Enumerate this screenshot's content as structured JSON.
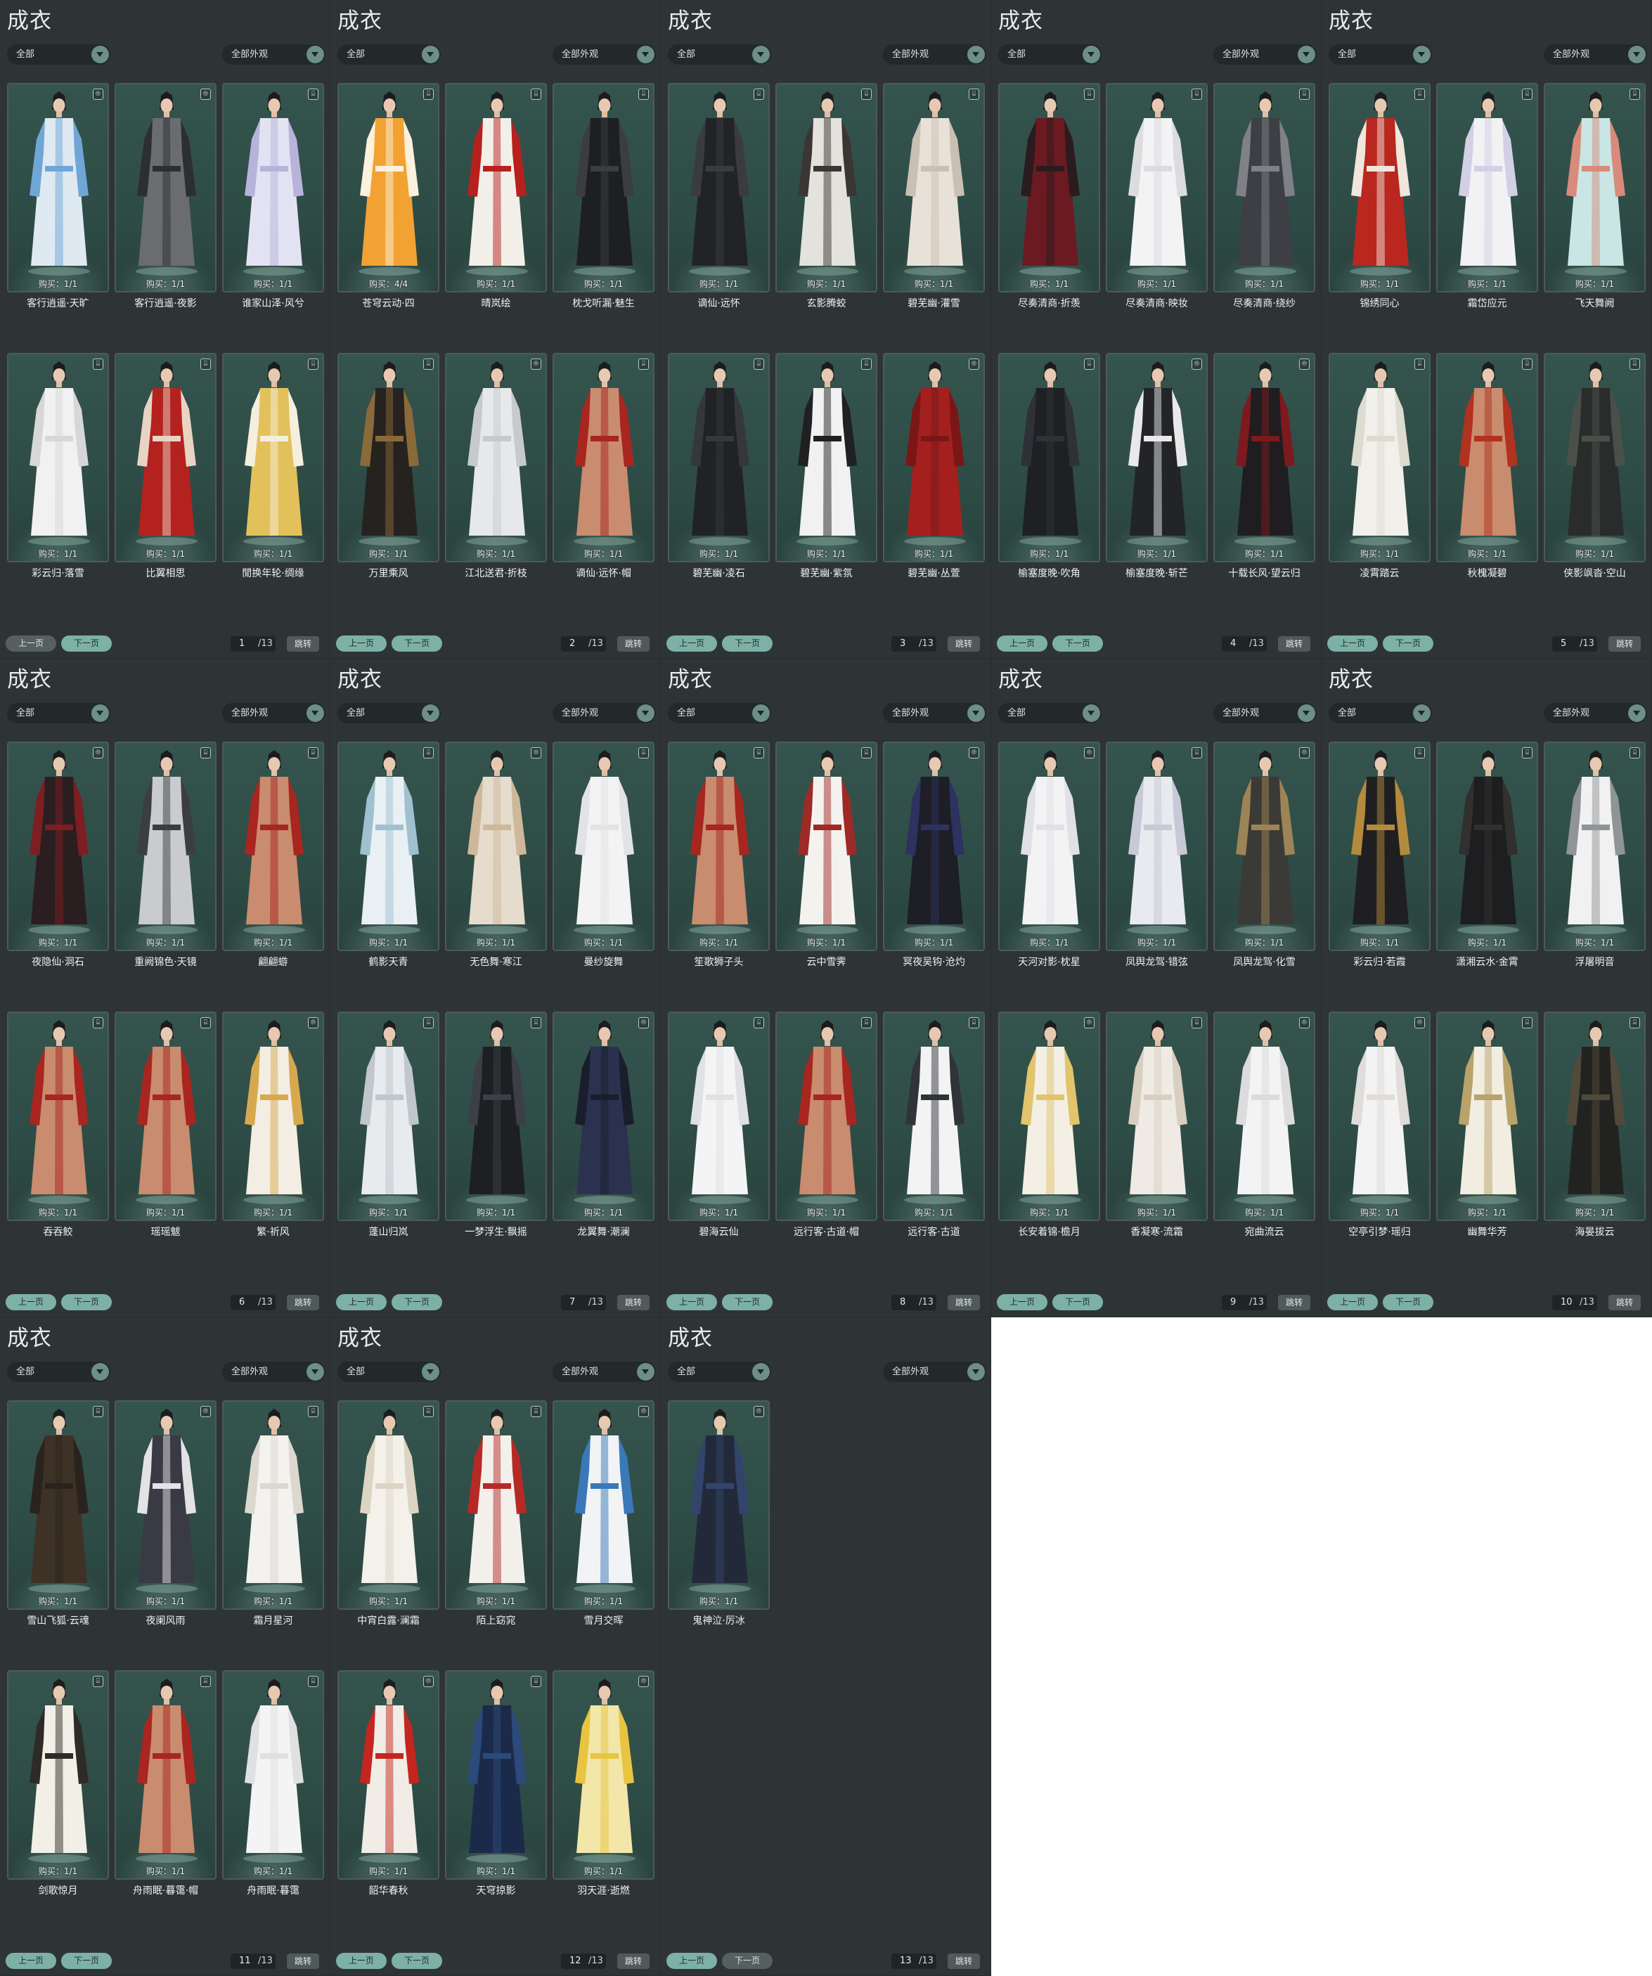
{
  "common": {
    "title": "成衣",
    "filter_left": "全部",
    "filter_right": "全部外观",
    "prev": "上一页",
    "next": "下一页",
    "total": "/13",
    "jump": "跳转"
  },
  "panels": [
    {
      "page": "1",
      "items": [
        {
          "name": "客行逍遥·天旷",
          "buy": "购买：1/1",
          "icon": "gift-icon",
          "colors": [
            "#dfe9f2",
            "#6fa6d6"
          ]
        },
        {
          "name": "客行逍遥·夜影",
          "buy": "购买：1/1",
          "icon": "gift-icon",
          "colors": [
            "#6a6c70",
            "#2d2e33"
          ]
        },
        {
          "name": "谁家山泽·风兮",
          "buy": "购买：1/1",
          "icon": "shop-icon",
          "colors": [
            "#e3e2f2",
            "#b7b3da"
          ]
        },
        {
          "name": "彩云归·落雪",
          "buy": "购买：1/1",
          "icon": "shop-icon",
          "colors": [
            "#f1f1f1",
            "#d7d7d7"
          ]
        },
        {
          "name": "比翼相思",
          "buy": "购买：1/1",
          "icon": "shop-icon",
          "colors": [
            "#b4221f",
            "#e9d3c4"
          ]
        },
        {
          "name": "閒换年轮·绸缘",
          "buy": "购买：1/1",
          "icon": "shop-icon",
          "colors": [
            "#e3c15a",
            "#f5efe0"
          ]
        }
      ]
    },
    {
      "page": "2",
      "items": [
        {
          "name": "苍穹云动·四",
          "buy": "购买：4/4",
          "icon": "shop-icon",
          "colors": [
            "#f2a233",
            "#fbf1dc"
          ]
        },
        {
          "name": "晴岚绘",
          "buy": "购买：1/1",
          "icon": "shop-icon",
          "colors": [
            "#f2efe9",
            "#b8201d"
          ]
        },
        {
          "name": "枕戈听漏·魅生",
          "buy": "购买：1/1",
          "icon": "shop-icon",
          "colors": [
            "#1e1f22",
            "#3b3d40"
          ]
        },
        {
          "name": "万里乘风",
          "buy": "购买：1/1",
          "icon": "shop-icon",
          "colors": [
            "#25221f",
            "#8b6a3a"
          ]
        },
        {
          "name": "江北送君·折枝",
          "buy": "购买：1/1",
          "icon": "gift-icon",
          "colors": [
            "#e6e8e9",
            "#c7cacc"
          ]
        },
        {
          "name": "谪仙·远怀·帽",
          "buy": "购买：1/1",
          "icon": "shop-icon",
          "colors": [
            "#c98c6e",
            "#a8261f"
          ]
        }
      ]
    },
    {
      "page": "3",
      "items": [
        {
          "name": "谪仙·远怀",
          "buy": "购买：1/1",
          "icon": "shop-icon",
          "colors": [
            "#222326",
            "#3a3b3f"
          ]
        },
        {
          "name": "玄影腾蛟",
          "buy": "购买：1/1",
          "icon": "shop-icon",
          "colors": [
            "#e4e2dd",
            "#3a3633"
          ]
        },
        {
          "name": "碧芜幽·灌雪",
          "buy": "购买：1/1",
          "icon": "shop-icon",
          "colors": [
            "#e8e1d8",
            "#c9bfb3"
          ]
        },
        {
          "name": "碧芜幽·凌石",
          "buy": "购买：1/1",
          "icon": "shop-icon",
          "colors": [
            "#202226",
            "#35373c"
          ]
        },
        {
          "name": "碧芜幽·紫氛",
          "buy": "购买：1/1",
          "icon": "shop-icon",
          "colors": [
            "#f1f1f1",
            "#1f2022"
          ]
        },
        {
          "name": "碧芜幽·丛萱",
          "buy": "购买：1/1",
          "icon": "gift-icon",
          "colors": [
            "#a3201f",
            "#7a1716"
          ]
        }
      ]
    },
    {
      "page": "4",
      "items": [
        {
          "name": "尽奏清商·折羡",
          "buy": "购买：1/1",
          "icon": "shop-icon",
          "colors": [
            "#6b1a22",
            "#2c1b1e"
          ]
        },
        {
          "name": "尽奏清商·映妆",
          "buy": "购买：1/1",
          "icon": "shop-icon",
          "colors": [
            "#f3f3f4",
            "#dadcdf"
          ]
        },
        {
          "name": "尽奏清商·绕纱",
          "buy": "购买：1/1",
          "icon": "shop-icon",
          "colors": [
            "#3d3f44",
            "#7f8186"
          ]
        },
        {
          "name": "榆塞度晚·吹角",
          "buy": "购买：1/1",
          "icon": "shop-icon",
          "colors": [
            "#1e2024",
            "#2f3136"
          ]
        },
        {
          "name": "榆塞度晚·斩芒",
          "buy": "购买：1/1",
          "icon": "gift-icon",
          "colors": [
            "#222428",
            "#e9e9e9"
          ]
        },
        {
          "name": "十载长风·望云归",
          "buy": "购买：1/1",
          "icon": "gift-icon",
          "colors": [
            "#1f1d20",
            "#7c1a1f"
          ]
        }
      ]
    },
    {
      "page": "5",
      "items": [
        {
          "name": "锦绣同心",
          "buy": "购买：1/1",
          "icon": "shop-icon",
          "colors": [
            "#b9271f",
            "#f0e6dc"
          ]
        },
        {
          "name": "霜岱应元",
          "buy": "购买：1/1",
          "icon": "shop-icon",
          "colors": [
            "#f2f1f4",
            "#d3cfe4"
          ]
        },
        {
          "name": "飞天舞阙",
          "buy": "购买：1/1",
          "icon": "shop-icon",
          "colors": [
            "#c9e6e4",
            "#d88b7b"
          ]
        },
        {
          "name": "凌霄踏云",
          "buy": "购买：1/1",
          "icon": "shop-icon",
          "colors": [
            "#f1f0ea",
            "#dedbd0"
          ]
        },
        {
          "name": "秋槐凝碧",
          "buy": "购买：1/1",
          "icon": "shop-icon",
          "colors": [
            "#c98c6e",
            "#b1321f"
          ]
        },
        {
          "name": "侠影飒沓·空山",
          "buy": "购买：1/1",
          "icon": "shop-icon",
          "colors": [
            "#2a2c2b",
            "#4b4f4a"
          ]
        }
      ]
    },
    {
      "page": "6",
      "items": [
        {
          "name": "夜隐仙·洞石",
          "buy": "购买：1/1",
          "icon": "gift-icon",
          "colors": [
            "#2a1e20",
            "#7d1e22"
          ]
        },
        {
          "name": "重阙锦色·天镜",
          "buy": "购买：1/1",
          "icon": "shop-icon",
          "colors": [
            "#c9cbce",
            "#3c3d41"
          ]
        },
        {
          "name": "翩翩蝣",
          "buy": "购买：1/1",
          "icon": "shop-icon",
          "colors": [
            "#c98c6e",
            "#a8261f"
          ]
        },
        {
          "name": "吞吞鲛",
          "buy": "购买：1/1",
          "icon": "shop-icon",
          "colors": [
            "#c98c6e",
            "#a8261f"
          ]
        },
        {
          "name": "瑶瑶魃",
          "buy": "购买：1/1",
          "icon": "shop-icon",
          "colors": [
            "#c98c6e",
            "#a8261f"
          ]
        },
        {
          "name": "繁·祈风",
          "buy": "购买：1/1",
          "icon": "gift-icon",
          "colors": [
            "#f3ede3",
            "#d7a94e"
          ]
        }
      ]
    },
    {
      "page": "7",
      "items": [
        {
          "name": "鹤影天青",
          "buy": "购买：1/1",
          "icon": "shop-icon",
          "colors": [
            "#e9f0f3",
            "#9fc1cf"
          ]
        },
        {
          "name": "无色舞·寒江",
          "buy": "购买：1/1",
          "icon": "gift-icon",
          "colors": [
            "#e6dccd",
            "#cdb89a"
          ]
        },
        {
          "name": "曼纱旋舞",
          "buy": "购买：1/1",
          "icon": "shop-icon",
          "colors": [
            "#f3f3f3",
            "#e1e3e6"
          ]
        },
        {
          "name": "蓬山归岚",
          "buy": "购买：1/1",
          "icon": "shop-icon",
          "colors": [
            "#e7ebee",
            "#bfc6cc"
          ]
        },
        {
          "name": "一梦浮生·飘摇",
          "buy": "购买：1/1",
          "icon": "shop-icon",
          "colors": [
            "#1d1f23",
            "#3c3f45"
          ]
        },
        {
          "name": "龙翼舞·潮澜",
          "buy": "购买：1/1",
          "icon": "gift-icon",
          "colors": [
            "#2b3250",
            "#1a1d2c"
          ]
        }
      ]
    },
    {
      "page": "8",
      "items": [
        {
          "name": "笙歌狮子头",
          "buy": "购买：1/1",
          "icon": "shop-icon",
          "colors": [
            "#c98c6e",
            "#a8261f"
          ]
        },
        {
          "name": "云中雪霁",
          "buy": "购买：1/1",
          "icon": "shop-icon",
          "colors": [
            "#f4f2ef",
            "#9d2a26"
          ]
        },
        {
          "name": "冥夜吴钩·沧灼",
          "buy": "购买：1/1",
          "icon": "gift-icon",
          "colors": [
            "#1d1e26",
            "#2d3260"
          ]
        },
        {
          "name": "碧海云仙",
          "buy": "购买：1/1",
          "icon": "shop-icon",
          "colors": [
            "#f4f4f5",
            "#dfe1e4"
          ]
        },
        {
          "name": "远行客·古道·帽",
          "buy": "购买：1/1",
          "icon": "shop-icon",
          "colors": [
            "#c98c6e",
            "#a8261f"
          ]
        },
        {
          "name": "远行客·古道",
          "buy": "购买：1/1",
          "icon": "shop-icon",
          "colors": [
            "#f3f3f3",
            "#303339"
          ]
        }
      ]
    },
    {
      "page": "9",
      "items": [
        {
          "name": "天河对影·枕星",
          "buy": "购买：1/1",
          "icon": "gift-icon",
          "colors": [
            "#f3f3f4",
            "#dfe1e6"
          ]
        },
        {
          "name": "凤舆龙驾·错弦",
          "buy": "购买：1/1",
          "icon": "shop-icon",
          "colors": [
            "#e9e9f0",
            "#c8c8d6"
          ]
        },
        {
          "name": "凤舆龙驾·化雪",
          "buy": "购买：1/1",
          "icon": "gift-icon",
          "colors": [
            "#3c3a36",
            "#9d8456"
          ]
        },
        {
          "name": "长安着锦·檐月",
          "buy": "购买：1/1",
          "icon": "gift-icon",
          "colors": [
            "#f3efe4",
            "#e2c46d"
          ]
        },
        {
          "name": "香凝寒·流霜",
          "buy": "购买：1/1",
          "icon": "shop-icon",
          "colors": [
            "#efebe4",
            "#d8cfc0"
          ]
        },
        {
          "name": "宛曲流云",
          "buy": "购买：1/1",
          "icon": "gift-icon",
          "colors": [
            "#f3f3f3",
            "#dcdcdc"
          ]
        }
      ]
    },
    {
      "page": "10",
      "items": [
        {
          "name": "彩云归·若霞",
          "buy": "购买：1/1",
          "icon": "shop-icon",
          "colors": [
            "#1f1f21",
            "#b48a3c"
          ]
        },
        {
          "name": "潇湘云水·金霄",
          "buy": "购买：1/1",
          "icon": "shop-icon",
          "colors": [
            "#1d1e20",
            "#31302e"
          ]
        },
        {
          "name": "浮屠明音",
          "buy": "购买：1/1",
          "icon": "shop-icon",
          "colors": [
            "#f1f1f1",
            "#8f9496"
          ]
        },
        {
          "name": "空亭引梦·瑶归",
          "buy": "购买：1/1",
          "icon": "gift-icon",
          "colors": [
            "#f3f3f3",
            "#e0dcda"
          ]
        },
        {
          "name": "幽舞华芳",
          "buy": "购买：1/1",
          "icon": "shop-icon",
          "colors": [
            "#f1ede0",
            "#b9a36b"
          ]
        },
        {
          "name": "海晏拔云",
          "buy": "购买：1/1",
          "icon": "shop-icon",
          "colors": [
            "#222321",
            "#514a3a"
          ]
        }
      ]
    },
    {
      "page": "11",
      "items": [
        {
          "name": "雪山飞狐·云魂",
          "buy": "购买：1/1",
          "icon": "shop-icon",
          "colors": [
            "#3e3226",
            "#2a231d"
          ]
        },
        {
          "name": "夜阑风雨",
          "buy": "购买：1/1",
          "icon": "gift-icon",
          "colors": [
            "#3a3a44",
            "#e3e3e6"
          ]
        },
        {
          "name": "霜月星河",
          "buy": "购买：1/1",
          "icon": "shop-icon",
          "colors": [
            "#f3f2ef",
            "#dcd8cf"
          ]
        },
        {
          "name": "剑歌惊月",
          "buy": "购买：1/1",
          "icon": "shop-icon",
          "colors": [
            "#f2efe6",
            "#2e2b27"
          ]
        },
        {
          "name": "舟雨眠·暮霭·帽",
          "buy": "购买：1/1",
          "icon": "shop-icon",
          "colors": [
            "#c98c6e",
            "#a8261f"
          ]
        },
        {
          "name": "舟雨眠·暮霭",
          "buy": "购买：1/1",
          "icon": "shop-icon",
          "colors": [
            "#f4f4f4",
            "#e0e0e0"
          ]
        }
      ]
    },
    {
      "page": "12",
      "items": [
        {
          "name": "中宵白露·澜霜",
          "buy": "购买：1/1",
          "icon": "shop-icon",
          "colors": [
            "#f3f1e9",
            "#dcd5c3"
          ]
        },
        {
          "name": "陌上窈窕",
          "buy": "购买：1/1",
          "icon": "shop-icon",
          "colors": [
            "#f3f0ec",
            "#b52a25"
          ]
        },
        {
          "name": "雪月交晖",
          "buy": "购买：1/1",
          "icon": "gift-icon",
          "colors": [
            "#f1f3f5",
            "#3a78b8"
          ]
        },
        {
          "name": "韶华春秋",
          "buy": "购买：1/1",
          "icon": "gift-icon",
          "colors": [
            "#f1ece6",
            "#c4261f"
          ]
        },
        {
          "name": "天穹掠影",
          "buy": "购买：1/1",
          "icon": "shop-icon",
          "colors": [
            "#1c2a4a",
            "#2c4a7a"
          ]
        },
        {
          "name": "羽天涯·逝燃",
          "buy": "购买：1/1",
          "icon": "gift-icon",
          "colors": [
            "#f2e6a8",
            "#e8c441"
          ]
        }
      ]
    },
    {
      "page": "13",
      "items": [
        {
          "name": "鬼神泣·厉冰",
          "buy": "购买：1/1",
          "icon": "gift-icon",
          "colors": [
            "#222a3a",
            "#33446a"
          ]
        }
      ]
    }
  ]
}
